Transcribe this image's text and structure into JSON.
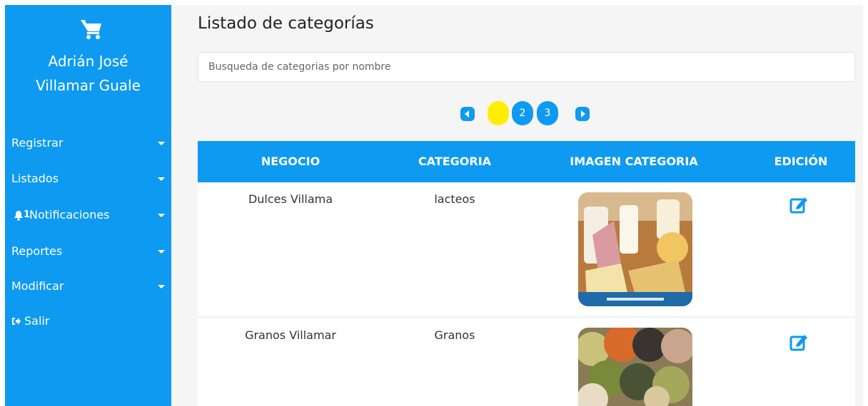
{
  "sidebar": {
    "user_line1": "Adrián José",
    "user_line2": "Villamar Guale",
    "cart_icon": "shopping-cart-icon",
    "items": [
      {
        "label": "Registrar"
      },
      {
        "label": "Listados"
      },
      {
        "label": "Notificaciones",
        "badge": "1"
      },
      {
        "label": "Reportes"
      },
      {
        "label": "Modificar"
      },
      {
        "label": "Salir"
      }
    ]
  },
  "main": {
    "title": "Listado de categorías",
    "search_placeholder": "Busqueda de categorias por nombre",
    "pagination": {
      "pages": [
        "1",
        "2",
        "3"
      ],
      "active_page": "1"
    },
    "table": {
      "headers": [
        "NEGOCIO",
        "CATEGORIA",
        "IMAGEN CATEGORIA",
        "EDICIÓN"
      ],
      "rows": [
        {
          "negocio": "Dulces Villama",
          "categoria": "lacteos",
          "image": "dairy-products-image"
        },
        {
          "negocio": "Granos Villamar",
          "categoria": "Granos",
          "image": "grains-image"
        }
      ]
    }
  },
  "colors": {
    "primary": "#0e9af0",
    "active_page": "#ffee00",
    "background": "#f5f5f5"
  }
}
